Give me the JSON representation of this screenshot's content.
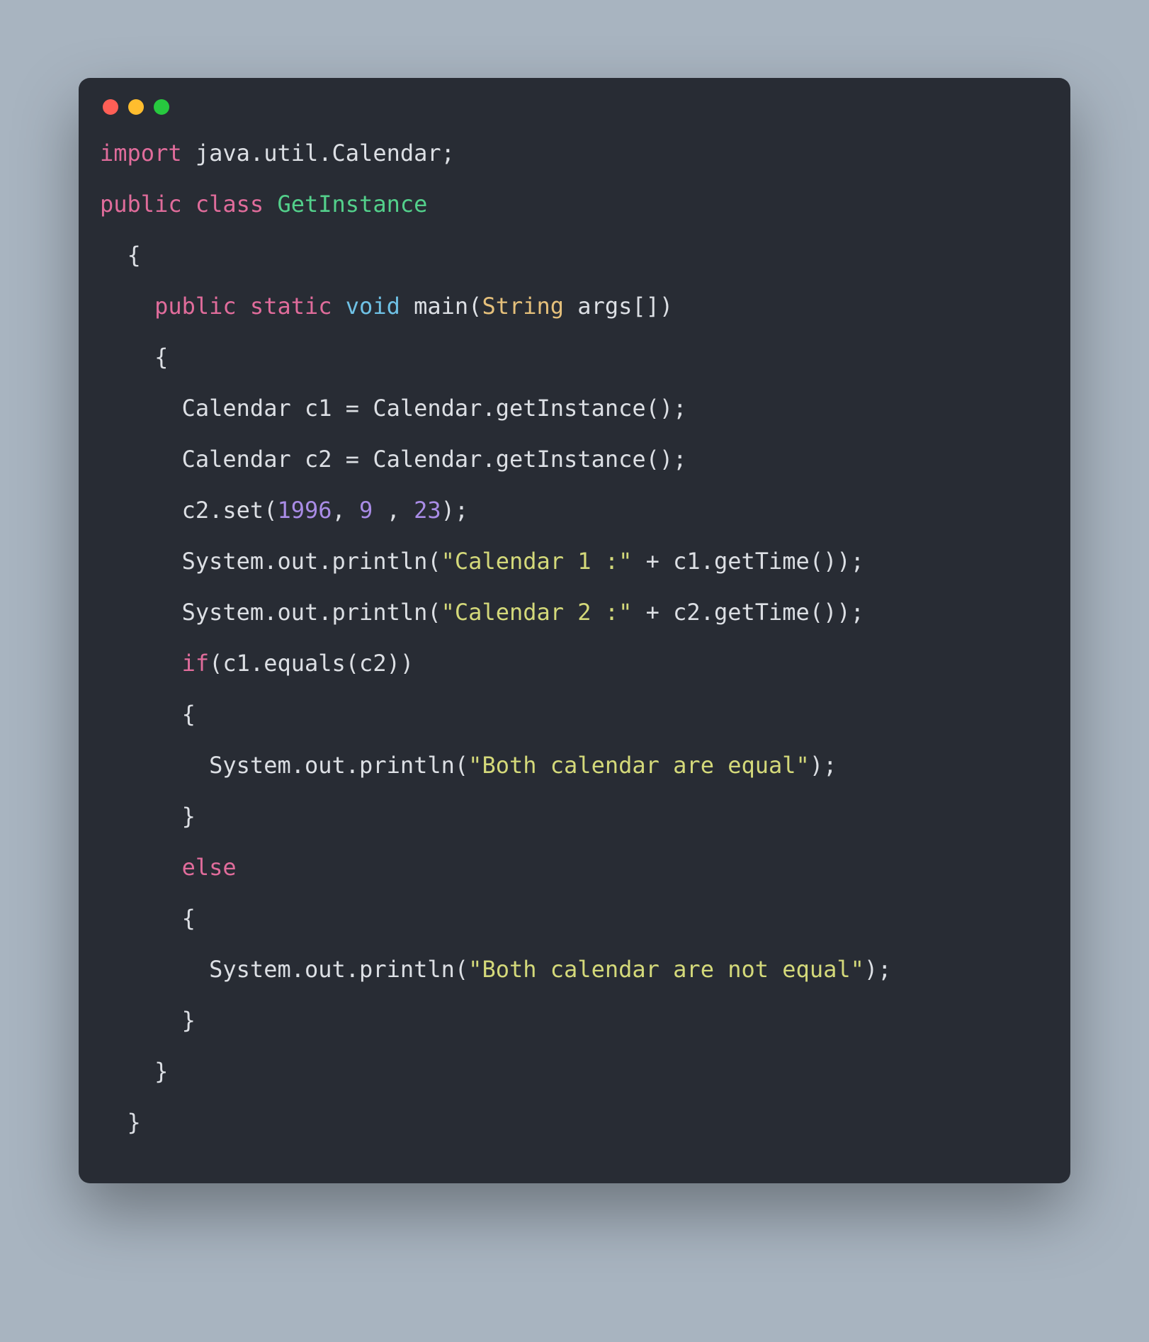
{
  "colors": {
    "background": "#A8B4C0",
    "editor_bg": "#282C34",
    "dot_red": "#FF5F56",
    "dot_yellow": "#FFBD2E",
    "dot_green": "#27C93F",
    "text": "#DCDFE4",
    "keyword": "#E06C9B",
    "type": "#6FC1E5",
    "classname": "#53D08B",
    "builtin": "#E5C07B",
    "number": "#A98CE6",
    "string": "#D4D97A"
  },
  "code": {
    "lines": [
      [
        {
          "t": "keyword",
          "v": "import"
        },
        {
          "t": "default",
          "v": " java.util.Calendar;"
        }
      ],
      [
        {
          "t": "keyword",
          "v": "public"
        },
        {
          "t": "default",
          "v": " "
        },
        {
          "t": "keyword",
          "v": "class"
        },
        {
          "t": "default",
          "v": " "
        },
        {
          "t": "class",
          "v": "GetInstance"
        }
      ],
      [
        {
          "t": "default",
          "v": "  { "
        }
      ],
      [
        {
          "t": "default",
          "v": "    "
        },
        {
          "t": "keyword",
          "v": "public"
        },
        {
          "t": "default",
          "v": " "
        },
        {
          "t": "keyword",
          "v": "static"
        },
        {
          "t": "default",
          "v": " "
        },
        {
          "t": "type",
          "v": "void"
        },
        {
          "t": "default",
          "v": " main("
        },
        {
          "t": "builtin",
          "v": "String"
        },
        {
          "t": "default",
          "v": " args[])"
        }
      ],
      [
        {
          "t": "default",
          "v": "    {"
        }
      ],
      [
        {
          "t": "default",
          "v": "      Calendar c1 = Calendar.getInstance();"
        }
      ],
      [
        {
          "t": "default",
          "v": "      Calendar c2 = Calendar.getInstance();"
        }
      ],
      [
        {
          "t": "default",
          "v": "      c2.set("
        },
        {
          "t": "number",
          "v": "1996"
        },
        {
          "t": "default",
          "v": ", "
        },
        {
          "t": "number",
          "v": "9"
        },
        {
          "t": "default",
          "v": " , "
        },
        {
          "t": "number",
          "v": "23"
        },
        {
          "t": "default",
          "v": ");"
        }
      ],
      [
        {
          "t": "default",
          "v": "      System.out.println("
        },
        {
          "t": "string",
          "v": "\"Calendar 1 :\""
        },
        {
          "t": "default",
          "v": " + c1.getTime());"
        }
      ],
      [
        {
          "t": "default",
          "v": "      System.out.println("
        },
        {
          "t": "string",
          "v": "\"Calendar 2 :\""
        },
        {
          "t": "default",
          "v": " + c2.getTime());"
        }
      ],
      [
        {
          "t": "default",
          "v": "      "
        },
        {
          "t": "keyword",
          "v": "if"
        },
        {
          "t": "default",
          "v": "(c1.equals(c2))"
        }
      ],
      [
        {
          "t": "default",
          "v": "      {"
        }
      ],
      [
        {
          "t": "default",
          "v": "        System.out.println("
        },
        {
          "t": "string",
          "v": "\"Both calendar are equal\""
        },
        {
          "t": "default",
          "v": ");"
        }
      ],
      [
        {
          "t": "default",
          "v": "      }"
        }
      ],
      [
        {
          "t": "default",
          "v": "      "
        },
        {
          "t": "keyword",
          "v": "else"
        }
      ],
      [
        {
          "t": "default",
          "v": "      {"
        }
      ],
      [
        {
          "t": "default",
          "v": "        System.out.println("
        },
        {
          "t": "string",
          "v": "\"Both calendar are not equal\""
        },
        {
          "t": "default",
          "v": ");"
        }
      ],
      [
        {
          "t": "default",
          "v": "      }"
        }
      ],
      [
        {
          "t": "default",
          "v": "    }"
        }
      ],
      [
        {
          "t": "default",
          "v": "  }"
        }
      ]
    ]
  }
}
